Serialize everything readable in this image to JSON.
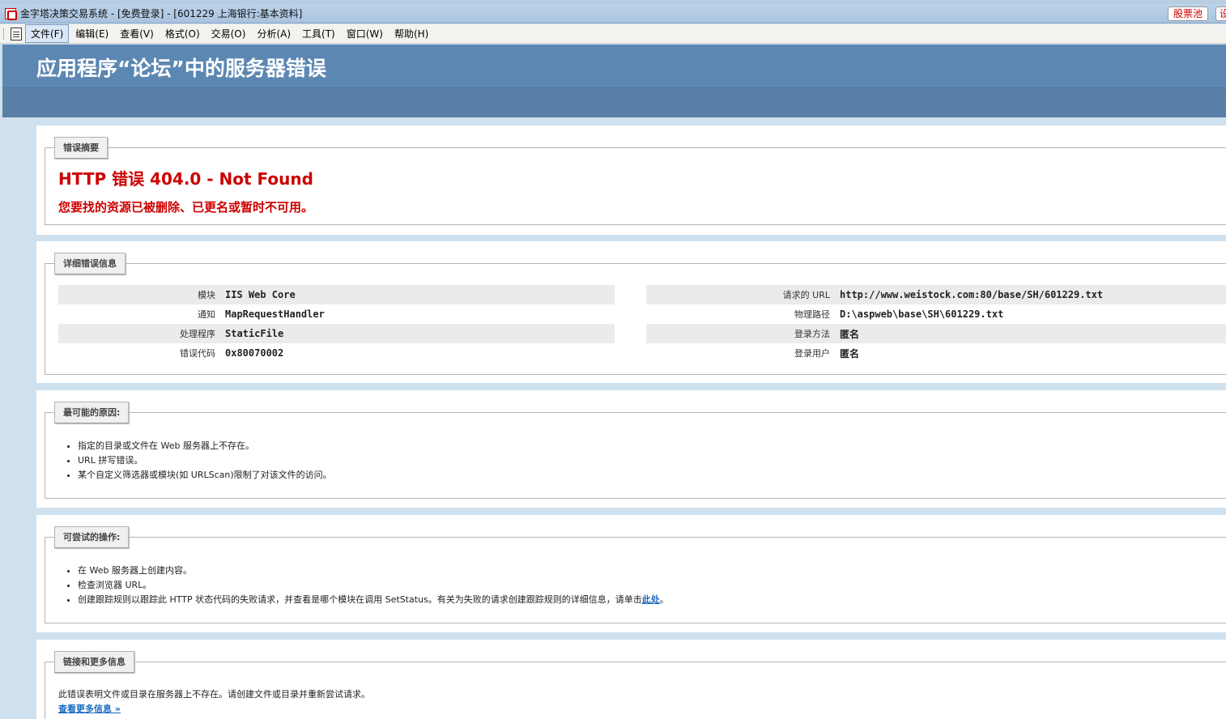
{
  "window": {
    "title": "金字塔决策交易系统 - [免费登录] - [601229 上海银行:基本资料]",
    "btn_stock_pool": "股票池",
    "btn_partial": "设"
  },
  "menu": {
    "items": [
      "文件(F)",
      "编辑(E)",
      "查看(V)",
      "格式(O)",
      "交易(O)",
      "分析(A)",
      "工具(T)",
      "窗口(W)",
      "帮助(H)"
    ]
  },
  "page": {
    "header_title": "应用程序“论坛”中的服务器错误"
  },
  "summary": {
    "legend": "错误摘要",
    "title": "HTTP 错误 404.0 - Not Found",
    "subtitle": "您要找的资源已被删除、已更名或暂时不可用。"
  },
  "details": {
    "legend": "详细错误信息",
    "left": [
      {
        "key": "模块",
        "value": "IIS Web Core"
      },
      {
        "key": "通知",
        "value": "MapRequestHandler"
      },
      {
        "key": "处理程序",
        "value": "StaticFile"
      },
      {
        "key": "错误代码",
        "value": "0x80070002"
      }
    ],
    "right": [
      {
        "key": "请求的 URL",
        "value": "http://www.weistock.com:80/base/SH/601229.txt"
      },
      {
        "key": "物理路径",
        "value": "D:\\aspweb\\base\\SH\\601229.txt"
      },
      {
        "key": "登录方法",
        "value": "匿名"
      },
      {
        "key": "登录用户",
        "value": "匿名"
      }
    ]
  },
  "causes": {
    "legend": "最可能的原因:",
    "items": [
      "指定的目录或文件在 Web 服务器上不存在。",
      "URL 拼写错误。",
      "某个自定义筛选器或模块(如 URLScan)限制了对该文件的访问。"
    ]
  },
  "actions": {
    "legend": "可尝试的操作:",
    "items": [
      "在 Web 服务器上创建内容。",
      "检查浏览器 URL。"
    ],
    "last_item_text": "创建跟踪规则以跟踪此 HTTP 状态代码的失败请求，并查看是哪个模块在调用 SetStatus。有关为失败的请求创建跟踪规则的详细信息，请单击",
    "last_item_link": "此处",
    "last_item_end": "。"
  },
  "links": {
    "legend": "链接和更多信息",
    "text": "此错误表明文件或目录在服务器上不存在。请创建文件或目录并重新尝试请求。",
    "more_link": "查看更多信息 »"
  }
}
